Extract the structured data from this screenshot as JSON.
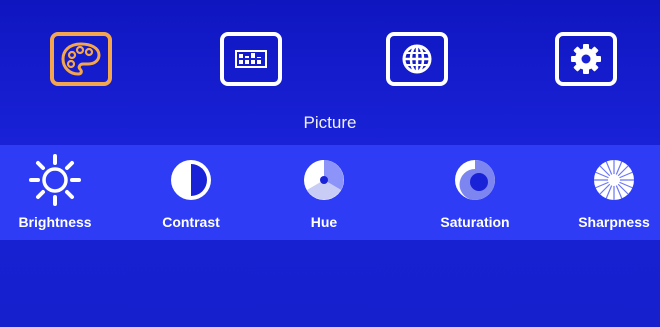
{
  "menu": {
    "tabs": [
      {
        "id": "picture",
        "icon": "palette-icon",
        "selected": true
      },
      {
        "id": "display",
        "icon": "equalizer-icon",
        "selected": false
      },
      {
        "id": "language",
        "icon": "globe-icon",
        "selected": false
      },
      {
        "id": "settings",
        "icon": "gear-icon",
        "selected": false
      }
    ],
    "title": "Picture",
    "items": [
      {
        "label": "Brightness",
        "icon": "sun-icon"
      },
      {
        "label": "Contrast",
        "icon": "contrast-icon"
      },
      {
        "label": "Hue",
        "icon": "hue-icon"
      },
      {
        "label": "Saturation",
        "icon": "saturation-icon"
      },
      {
        "label": "Sharpness",
        "icon": "sharpness-icon"
      }
    ]
  },
  "colors": {
    "background": "#1a22d8",
    "band": "#2e3df5",
    "selected_border": "#f4a64f",
    "text": "#ffffff"
  }
}
